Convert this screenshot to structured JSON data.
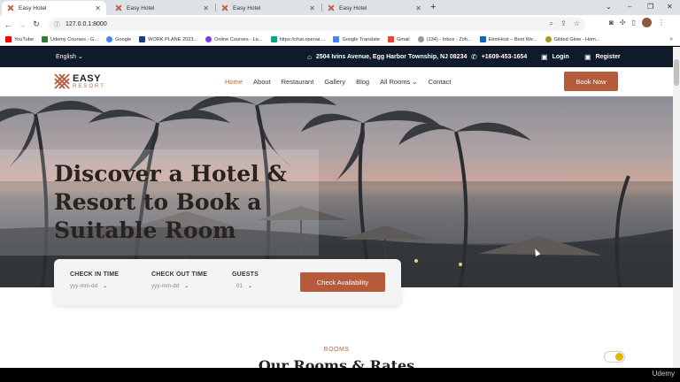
{
  "browser": {
    "tabs": [
      {
        "title": "Easy Hotel",
        "active": true
      },
      {
        "title": "Easy Hotel",
        "active": false
      },
      {
        "title": "Easy Hotel",
        "active": false
      },
      {
        "title": "Easy Hotel",
        "active": false
      }
    ],
    "new_tab": "+",
    "window_controls": {
      "minimize": "–",
      "restore": "❐",
      "close": "✕",
      "menu": "⌄"
    },
    "url": "127.0.0.1:8000",
    "bookmarks": [
      {
        "label": "YouTube",
        "color": "#ff0000"
      },
      {
        "label": "Udemy Courses - G...",
        "color": "#2e7d32"
      },
      {
        "label": "Google",
        "color": "#4285f4"
      },
      {
        "label": "WORK PLANE 2023...",
        "color": "#1e3a8a"
      },
      {
        "label": "Online Courses - Le...",
        "color": "#7c3aed"
      },
      {
        "label": "https://chat.openai....",
        "color": "#10a37f"
      },
      {
        "label": "Google Translate",
        "color": "#4285f4"
      },
      {
        "label": "Gmail",
        "color": "#ea4335"
      },
      {
        "label": "(134) - Inbox - Zoh...",
        "color": "#999999"
      },
      {
        "label": "EbmHost – Best We...",
        "color": "#1565c0"
      },
      {
        "label": "Gilded Glow - Hom...",
        "color": "#9e9d24"
      }
    ],
    "bookmarks_more": "»"
  },
  "topbar": {
    "language": "English",
    "address": "2504 Ivins Avenue, Egg Harbor Township, NJ 08234",
    "phone": "+1609-453-1654",
    "login": "Login",
    "register": "Register"
  },
  "nav": {
    "logo_main": "EASY",
    "logo_sub": "RESORT",
    "items": [
      {
        "label": "Home",
        "active": true
      },
      {
        "label": "About"
      },
      {
        "label": "Restaurant"
      },
      {
        "label": "Gallery"
      },
      {
        "label": "Blog"
      },
      {
        "label": "All Rooms"
      },
      {
        "label": "Contact"
      }
    ],
    "book_now": "Book Now"
  },
  "hero": {
    "title": "Discover a Hotel & Resort to Book a Suitable Room"
  },
  "booking": {
    "check_in_label": "CHECK IN TIME",
    "check_in_value": "yyy-mm-dd",
    "check_out_label": "CHECK OUT TIME",
    "check_out_value": "yyy-mm-dd",
    "guests_label": "GUESTS",
    "guests_value": "01",
    "submit": "Check Availability"
  },
  "rooms": {
    "eyebrow": "ROOMS",
    "heading": "Our Rooms & Rates"
  },
  "overlay": {
    "watermark": "Udemy"
  },
  "colors": {
    "accent": "#b65a3c",
    "topbar": "#101a2b"
  }
}
